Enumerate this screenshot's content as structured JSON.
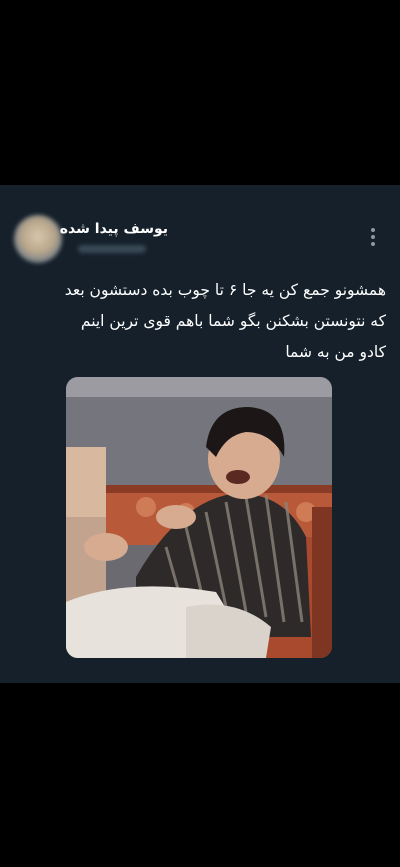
{
  "tweet": {
    "author": {
      "display_name": "یوسف پیدا شده",
      "avatar_icon": "avatar-photo"
    },
    "more_icon": "more-vertical-icon",
    "text_lines": [
      "همشونو جمع کن یه جا ۶ تا چوب بده دستشون بعد",
      "که نتونستن بشکنن بگو شما باهم قوی ترین اینم",
      "کادو من به شما"
    ],
    "media": {
      "type": "photo"
    }
  },
  "colors": {
    "background": "#000000",
    "card_background": "#15202b",
    "text": "#ffffff",
    "icon_muted": "#8899a6"
  }
}
